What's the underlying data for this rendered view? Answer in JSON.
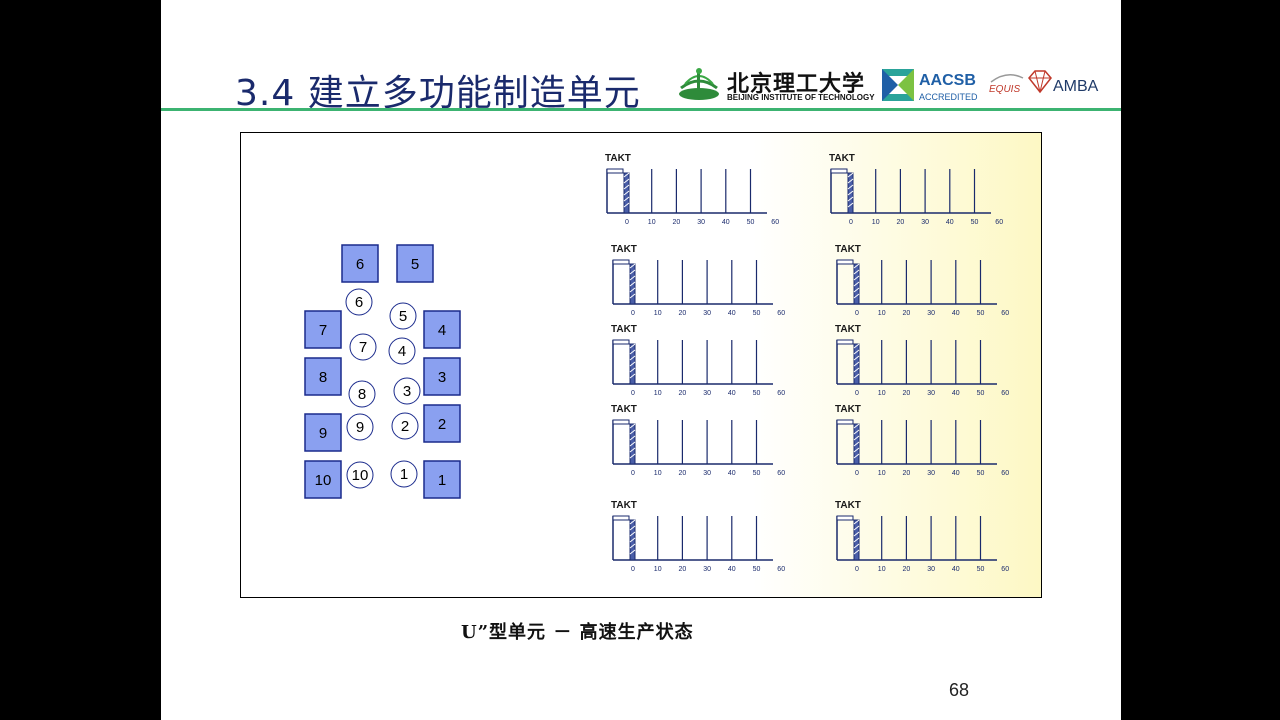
{
  "slide": {
    "title": "3.4 建立多功能制造单元",
    "caption": "U”型单元 － 高速生产状态",
    "page_number": "68"
  },
  "logos": {
    "bit_name_zh": "北京理工大学",
    "bit_name_en": "BEIJING INSTITUTE OF TECHNOLOGY",
    "aacsb": "AACSB",
    "aacsb_sub": "ACCREDITED",
    "equis": "EQUIS",
    "amba": "AMBA"
  },
  "cell_layout": {
    "machines": [
      "1",
      "2",
      "3",
      "4",
      "5",
      "6",
      "7",
      "8",
      "9",
      "10"
    ],
    "operators": [
      "1",
      "2",
      "3",
      "4",
      "5",
      "6",
      "7",
      "8",
      "9",
      "10"
    ],
    "colors": {
      "machine_fill": "#8aa0f0",
      "machine_border": "#1a2a8c"
    }
  },
  "takt_charts": {
    "label": "TAKT",
    "tick_labels": [
      "0",
      "10",
      "20",
      "30",
      "40",
      "50",
      "60"
    ],
    "count": 10
  }
}
